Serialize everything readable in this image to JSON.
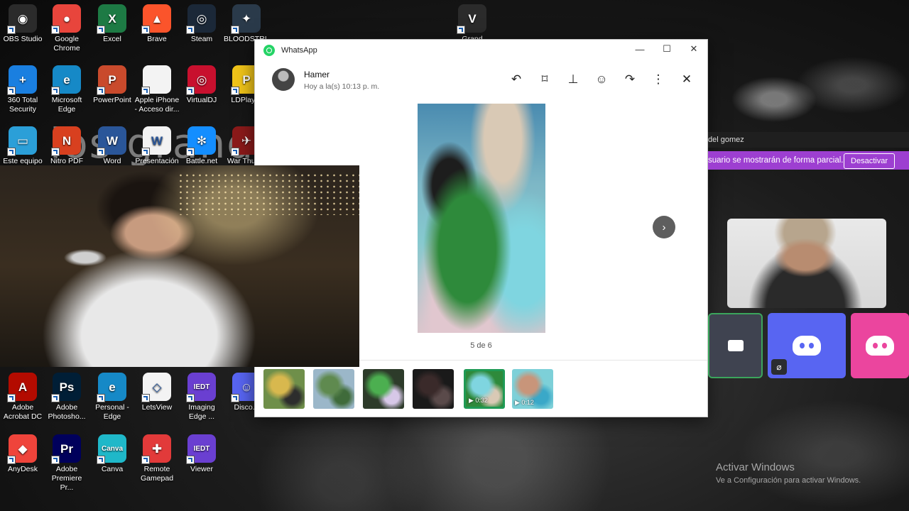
{
  "desktop_bg_text": "los grande",
  "desktop_icons": [
    {
      "label": "OBS Studio",
      "color": "#2b2b2b",
      "glyph": "◉"
    },
    {
      "label": "Google Chrome",
      "color": "#e8453c",
      "glyph": "●"
    },
    {
      "label": "Excel",
      "color": "#1d7a44",
      "glyph": "X"
    },
    {
      "label": "Brave",
      "color": "#fb542b",
      "glyph": "▲"
    },
    {
      "label": "Steam",
      "color": "#1b2838",
      "glyph": "◎"
    },
    {
      "label": "BLOODSTRI...",
      "color": "#2a3a4a",
      "glyph": "✦"
    },
    {
      "label": "360 Total Security",
      "color": "#1a7fe0",
      "glyph": "+"
    },
    {
      "label": "Microsoft Edge",
      "color": "#1689c7",
      "glyph": "e"
    },
    {
      "label": "PowerPoint",
      "color": "#c94a2c",
      "glyph": "P"
    },
    {
      "label": "Apple iPhone - Acceso dir...",
      "color": "#f3f3f3",
      "glyph": ""
    },
    {
      "label": "VirtualDJ",
      "color": "#c8102e",
      "glyph": "◎"
    },
    {
      "label": "LDPlayer",
      "color": "#f0c419",
      "glyph": "P"
    },
    {
      "label": "Este equipo",
      "color": "#2b9fd8",
      "glyph": "▭"
    },
    {
      "label": "Nitro PDF Pro",
      "color": "#d8401f",
      "glyph": "N"
    },
    {
      "label": "Word",
      "color": "#2a5699",
      "glyph": "W"
    },
    {
      "label": "Presentación",
      "color": "#f3f3f3",
      "glyph": "W"
    },
    {
      "label": "Battle.net",
      "color": "#148eff",
      "glyph": "✻"
    },
    {
      "label": "War Thun...",
      "color": "#8b1a1a",
      "glyph": "✈"
    },
    {
      "label": "Adobe Acrobat DC",
      "color": "#b30b00",
      "glyph": "A"
    },
    {
      "label": "Adobe Photosho...",
      "color": "#001e36",
      "glyph": "Ps"
    },
    {
      "label": "Personal - Edge",
      "color": "#1689c7",
      "glyph": "e"
    },
    {
      "label": "LetsView",
      "color": "#f3f3f3",
      "glyph": "◇"
    },
    {
      "label": "Imaging Edge ...",
      "color": "#6a3fd1",
      "glyph": "IEDT"
    },
    {
      "label": "Disco...",
      "color": "#5865f2",
      "glyph": "☺"
    },
    {
      "label": "AnyDesk",
      "color": "#ef443b",
      "glyph": "◆"
    },
    {
      "label": "Adobe Premiere Pr...",
      "color": "#00005b",
      "glyph": "Pr"
    },
    {
      "label": "Canva",
      "color": "#1fb8c9",
      "glyph": "Canva"
    },
    {
      "label": "Remote Gamepad",
      "color": "#e23a3a",
      "glyph": "✚"
    },
    {
      "label": "Viewer",
      "color": "#6a3fd1",
      "glyph": "IEDT"
    },
    {
      "label": "Grand Theft...",
      "color": "#2b2b2b",
      "glyph": "V"
    }
  ],
  "whatsapp": {
    "title": "WhatsApp",
    "window_controls": {
      "minimize": "—",
      "maximize": "☐",
      "close": "✕"
    },
    "contact_name": "Hamer",
    "contact_time": "Hoy a la(s) 10:13 p. m.",
    "header_icons": [
      "reply-icon",
      "bookmark-icon",
      "pin-icon",
      "emoji-icon",
      "forward-icon",
      "more-icon",
      "close-icon"
    ],
    "header_glyphs": {
      "reply": "↶",
      "bookmark": "⌑",
      "pin": "⊥",
      "emoji": "☺",
      "forward": "↷",
      "more": "⋮",
      "close": "✕"
    },
    "counter": "5 de 6",
    "next_glyph": "›",
    "thumbnails": [
      {
        "colors": [
          "#6f8f4a",
          "#d8b84e",
          "#2d2d2d"
        ],
        "duration": ""
      },
      {
        "colors": [
          "#9bb7c9",
          "#5f8a4f",
          "#3f6b3a"
        ],
        "duration": ""
      },
      {
        "colors": [
          "#2d3b2a",
          "#4caf50",
          "#d7c8e8"
        ],
        "duration": ""
      },
      {
        "colors": [
          "#1a1a1a",
          "#3a2a2a",
          "#5a4a4a"
        ],
        "duration": ""
      },
      {
        "colors": [
          "#2e8a3b",
          "#7fd5e0",
          "#d9c9b5"
        ],
        "duration": "0:32",
        "selected": true
      },
      {
        "colors": [
          "#7dd0d8",
          "#c8957a",
          "#3aa8c8"
        ],
        "duration": "0:12"
      }
    ]
  },
  "discord": {
    "bar_title": "del gomez",
    "notice": "suario se mostrarán de forma parcial.",
    "notice_button": "Desactivar",
    "tile_colors": [
      "#3f4350",
      "#5865f2",
      "#eb459e"
    ]
  },
  "activate_windows": {
    "title": "Activar Windows",
    "subtitle": "Ve a Configuración para activar Windows."
  }
}
